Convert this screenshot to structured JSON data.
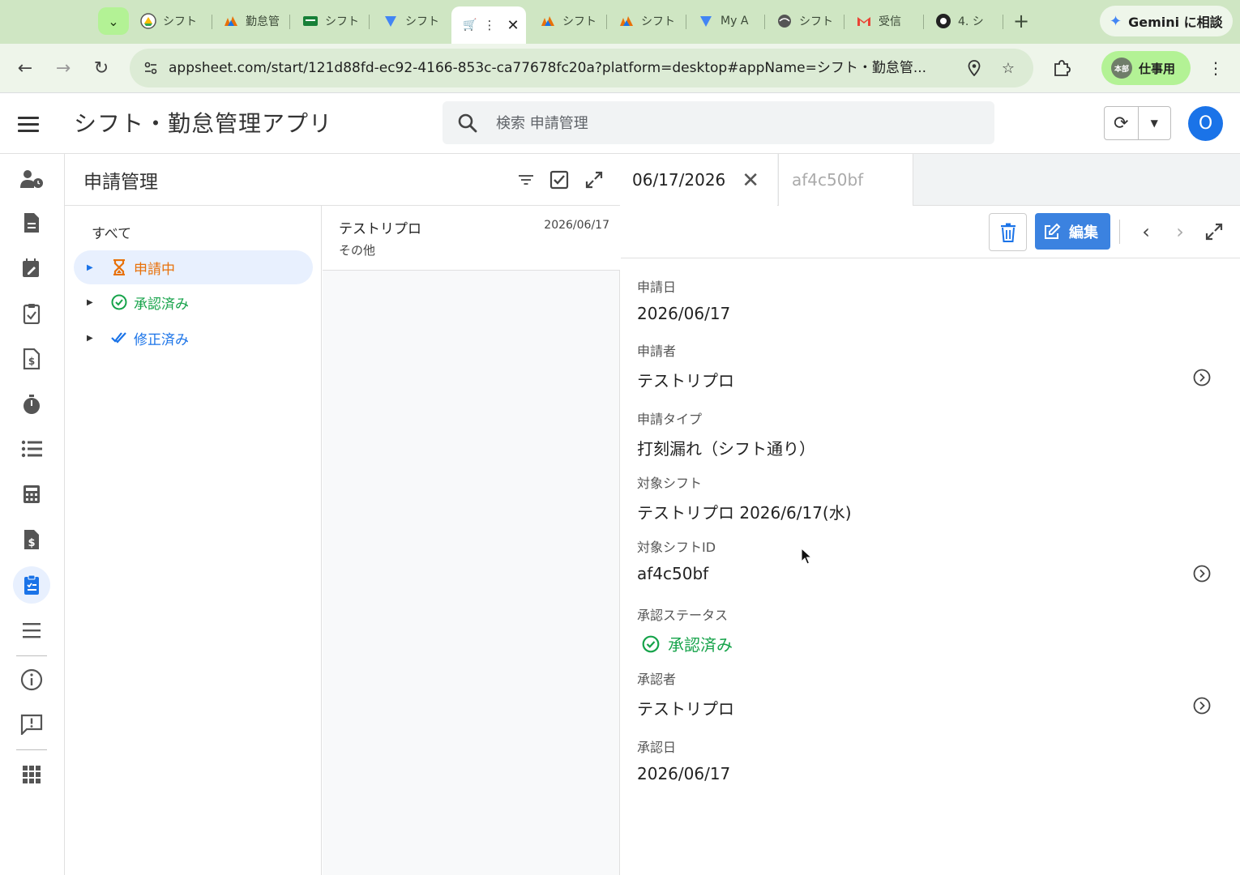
{
  "browser": {
    "tabs": [
      {
        "label": "シフト",
        "icon": "chrome-drive-icon"
      },
      {
        "label": "勤怠管",
        "icon": "appsheet-icon"
      },
      {
        "label": "シフト",
        "icon": "sheets-icon"
      },
      {
        "label": "シフト",
        "icon": "forms-icon"
      },
      {
        "label": "シフト",
        "icon": "appsheet-icon"
      },
      {
        "label": "シフト",
        "icon": "appsheet-icon"
      },
      {
        "label": "My A",
        "icon": "forms-icon"
      },
      {
        "label": "シフト",
        "icon": "globe-icon"
      },
      {
        "label": "受信",
        "icon": "gmail-icon"
      },
      {
        "label": "4. シ",
        "icon": "github-icon"
      }
    ],
    "active_tab_label": "⋮",
    "gemini_label": "Gemini に相談",
    "url": "appsheet.com/start/121d88fd-ec92-4166-853c-ca77678fc20a?platform=desktop#appName=シフト・勤怠管...",
    "profile_badge": "本部",
    "profile_label": "仕事用"
  },
  "app": {
    "title": "シフト・勤怠管理アプリ",
    "search_placeholder": "検索 申請管理",
    "user_initial": "O"
  },
  "rail": [
    {
      "name": "staff-icon"
    },
    {
      "name": "document-icon"
    },
    {
      "name": "calendar-edit-icon"
    },
    {
      "name": "clipboard-check-icon"
    },
    {
      "name": "invoice-icon"
    },
    {
      "name": "stopwatch-icon"
    },
    {
      "name": "list-icon"
    },
    {
      "name": "calculator-icon"
    },
    {
      "name": "dollar-file-icon"
    },
    {
      "name": "clipboard-list-icon",
      "active": true
    },
    {
      "name": "menu-lines-icon"
    },
    {
      "name": "info-icon"
    },
    {
      "name": "feedback-icon"
    },
    {
      "name": "apps-grid-icon"
    }
  ],
  "panel": {
    "title": "申請管理",
    "all_label": "すべて",
    "groups": [
      {
        "label": "申請中",
        "color": "#e8710a",
        "icon": "hourglass-icon"
      },
      {
        "label": "承認済み",
        "color": "#16a34a",
        "icon": "check-circle-icon"
      },
      {
        "label": "修正済み",
        "color": "#1a73e8",
        "icon": "double-check-icon"
      }
    ]
  },
  "list": {
    "rows": [
      {
        "name": "テストリプロ",
        "sub": "その他",
        "date": "2026/06/17"
      }
    ]
  },
  "detail": {
    "tab_active": "06/17/2026",
    "tab_inactive": "af4c50bf",
    "edit_label": "編集",
    "fields": [
      {
        "label": "申請日",
        "value": "2026/06/17"
      },
      {
        "label": "申請者",
        "value": "テストリプロ"
      },
      {
        "label": "申請タイプ",
        "value": "打刻漏れ（シフト通り）"
      },
      {
        "label": "対象シフト",
        "value": "テストリプロ 2026/6/17(水)"
      },
      {
        "label": "対象シフトID",
        "value": "af4c50bf"
      },
      {
        "label": "承認ステータス",
        "value": "承認済み"
      },
      {
        "label": "承認者",
        "value": "テストリプロ"
      },
      {
        "label": "承認日",
        "value": "2026/06/17"
      }
    ]
  },
  "colors": {
    "accent": "#3b82e0",
    "pending": "#e8710a",
    "approved": "#16a34a",
    "revised": "#1a73e8"
  }
}
